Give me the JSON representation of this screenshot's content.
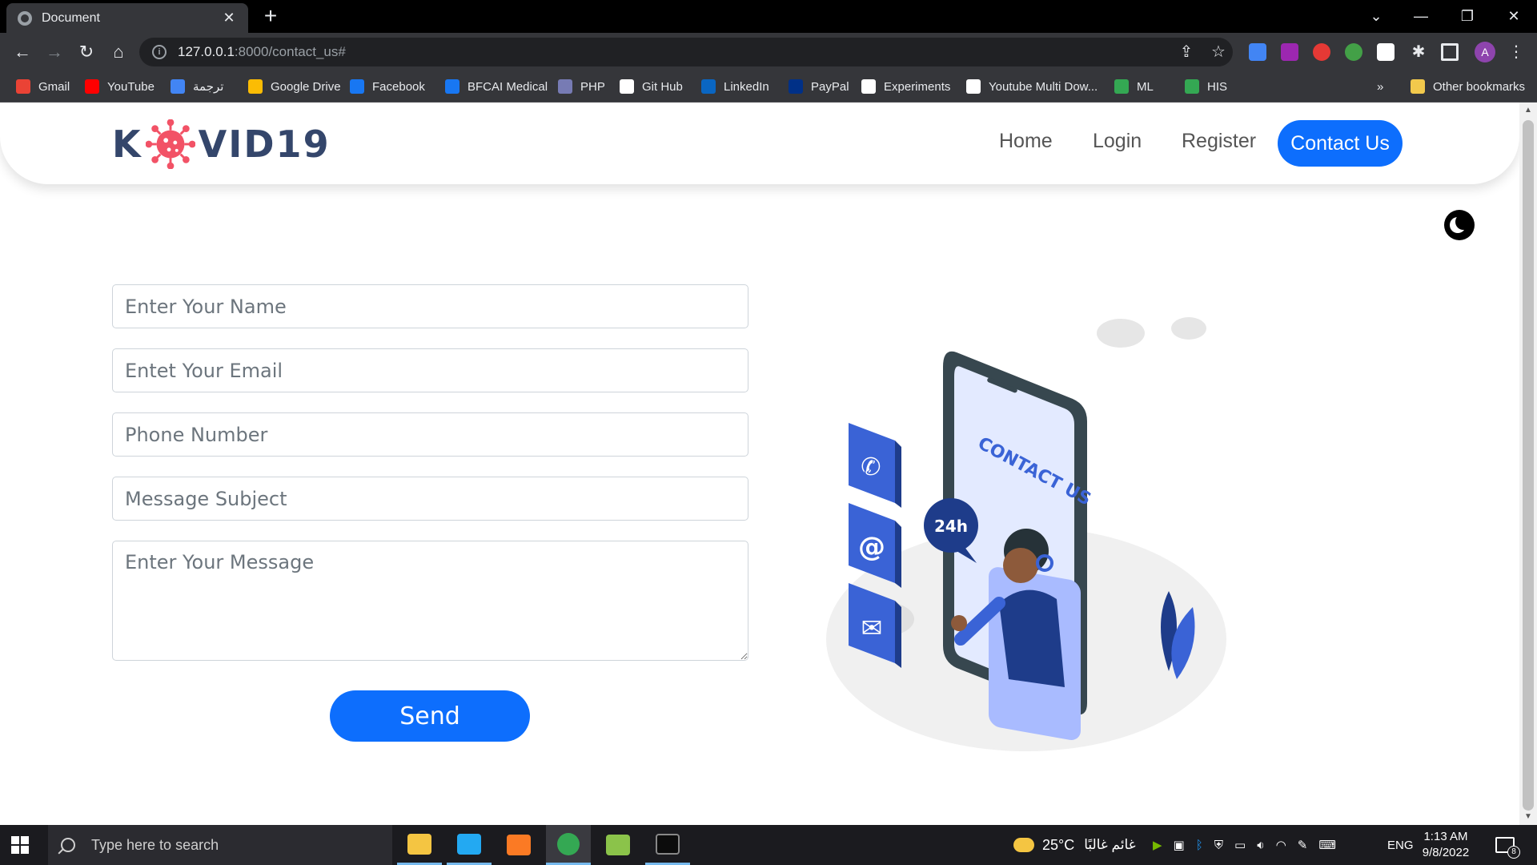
{
  "browser": {
    "tab_title": "Document",
    "url_host": "127.0.0.1",
    "url_path": ":8000/contact_us#",
    "bookmarks": [
      {
        "label": "Gmail",
        "color": "#ea4335"
      },
      {
        "label": "YouTube",
        "color": "#ff0000"
      },
      {
        "label": "ترجمة",
        "color": "#4285f4"
      },
      {
        "label": "Google Drive",
        "color": "#fbbc04"
      },
      {
        "label": "Facebook",
        "color": "#1877f2"
      },
      {
        "label": "BFCAI Medical",
        "color": "#1877f2"
      },
      {
        "label": "PHP",
        "color": "#777bb4"
      },
      {
        "label": "Git Hub",
        "color": "#ffffff"
      },
      {
        "label": "LinkedIn",
        "color": "#0a66c2"
      },
      {
        "label": "PayPal",
        "color": "#003087"
      },
      {
        "label": "Experiments",
        "color": "#ffffff"
      },
      {
        "label": "Youtube Multi Dow...",
        "color": "#ffffff"
      },
      {
        "label": "ML",
        "color": "#34a853"
      },
      {
        "label": "HIS",
        "color": "#34a853"
      }
    ],
    "more_bookmarks": "»",
    "other_bookmarks": "Other bookmarks",
    "avatar_letter": "A"
  },
  "site": {
    "logo_left": "K",
    "logo_right": "VID19",
    "nav": [
      "Home",
      "Login",
      "Register",
      "Contact Us"
    ],
    "accent": "#0d6efd",
    "form": {
      "name_placeholder": "Enter Your Name",
      "email_placeholder": "Entet Your Email",
      "phone_placeholder": "Phone Number",
      "subject_placeholder": "Message Subject",
      "message_placeholder": "Enter Your Message",
      "send_label": "Send"
    },
    "illustration": {
      "badge": "24h",
      "screen_text": "CONTACT US"
    }
  },
  "taskbar": {
    "search_placeholder": "Type here to search",
    "weather": "25°C",
    "weather_desc": "غائم غالبًا",
    "lang": "ENG",
    "time": "1:13 AM",
    "date": "9/8/2022",
    "notification_count": "8"
  }
}
